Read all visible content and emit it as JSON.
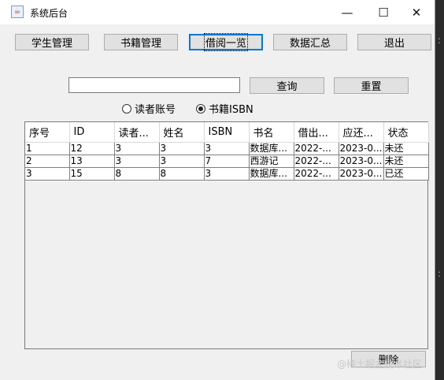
{
  "window": {
    "title": "系统后台"
  },
  "nav": [
    {
      "label": "学生管理"
    },
    {
      "label": "书籍管理"
    },
    {
      "label": "借阅一览"
    },
    {
      "label": "数据汇总"
    },
    {
      "label": "退出"
    }
  ],
  "search": {
    "value": "",
    "query_label": "查询",
    "reset_label": "重置"
  },
  "filters": {
    "options": [
      {
        "label": "读者账号",
        "selected": false
      },
      {
        "label": "书籍ISBN",
        "selected": true
      }
    ]
  },
  "table": {
    "columns": [
      "序号",
      "ID",
      "读者...",
      "姓名",
      "ISBN",
      "书名",
      "借出...",
      "应还...",
      "状态"
    ],
    "rows": [
      [
        "1",
        "12",
        "3",
        "3",
        "3",
        "数据库...",
        "2022-...",
        "2023-0...",
        "未还"
      ],
      [
        "2",
        "13",
        "3",
        "3",
        "7",
        "西游记",
        "2022-...",
        "2023-0...",
        "未还"
      ],
      [
        "3",
        "15",
        "8",
        "8",
        "3",
        "数据库...",
        "2022-...",
        "2023-0...",
        "已还"
      ]
    ]
  },
  "actions": {
    "delete_label": "删除"
  },
  "watermark": "@稀土掘金技术社区",
  "colors": {
    "focus_border": "#0078d7",
    "button_bg": "#e1e1e1",
    "window_bg": "#f0f0f0"
  }
}
